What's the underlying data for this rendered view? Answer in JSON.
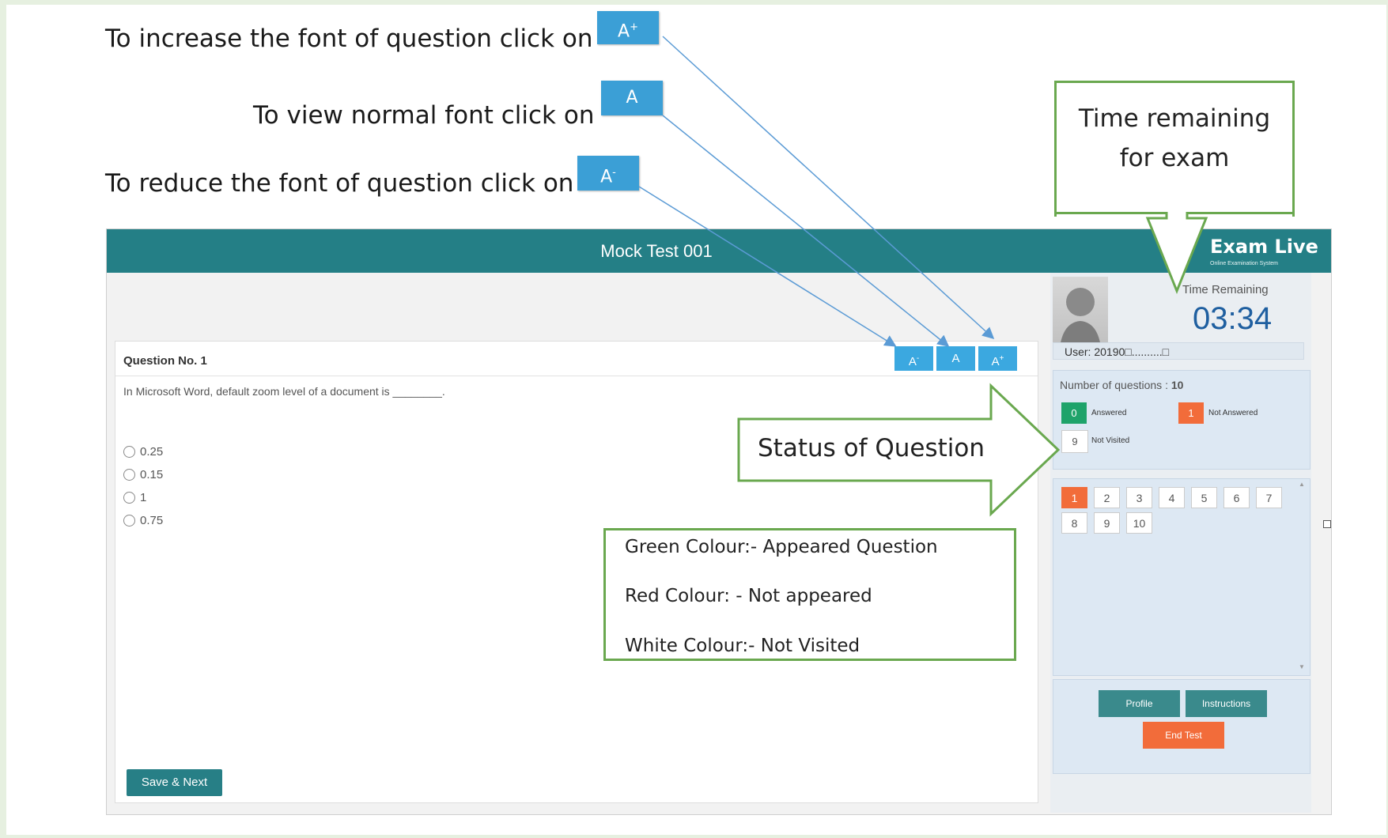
{
  "instructions": {
    "increase": "To increase the font of question click on",
    "normal": "To view normal font click on",
    "reduce": "To reduce the font of question click on"
  },
  "font_buttons": {
    "increase_label": "A",
    "increase_sup": "+",
    "normal_label": "A",
    "reduce_label": "A",
    "reduce_sup": "-"
  },
  "callouts": {
    "time_line1": "Time remaining",
    "time_line2": "for exam",
    "status": "Status of Question",
    "legend": [
      "Green Colour:- Appeared Question",
      "Red Colour: - Not appeared",
      "White Colour:- Not Visited"
    ]
  },
  "app": {
    "title": "Mock Test 001",
    "brand": "Exam Live",
    "brand_sub": "Online Examination System",
    "question": {
      "number_label": "Question No. 1",
      "text": "In Microsoft Word, default zoom level of a document is ________.",
      "options": [
        "0.25",
        "0.15",
        "1",
        "0.75"
      ],
      "save_next": "Save & Next"
    },
    "font_controls": [
      "A-",
      "A",
      "A+"
    ],
    "sidebar": {
      "time_label": "Time Remaining",
      "time_value": "03:34",
      "user": "User: 20190□..........□",
      "num_questions_label": "Number of questions :",
      "num_questions_value": "10",
      "status": [
        {
          "count": "0",
          "label": "Answered",
          "color": "#1ea36a"
        },
        {
          "count": "1",
          "label": "Not Answered",
          "color": "#f26c3a"
        },
        {
          "count": "9",
          "label": "Not Visited",
          "color": "#ffffff"
        }
      ],
      "palette": [
        "1",
        "2",
        "3",
        "4",
        "5",
        "6",
        "7",
        "8",
        "9",
        "10"
      ],
      "profile": "Profile",
      "instructions": "Instructions",
      "end_test": "End Test"
    }
  },
  "colors": {
    "header": "#247f86",
    "callout_border": "#6aa84f",
    "accent_blue": "#3ba8e0",
    "arrow": "#5b9bd5",
    "answered": "#1ea36a",
    "not_answered": "#f26c3a"
  }
}
